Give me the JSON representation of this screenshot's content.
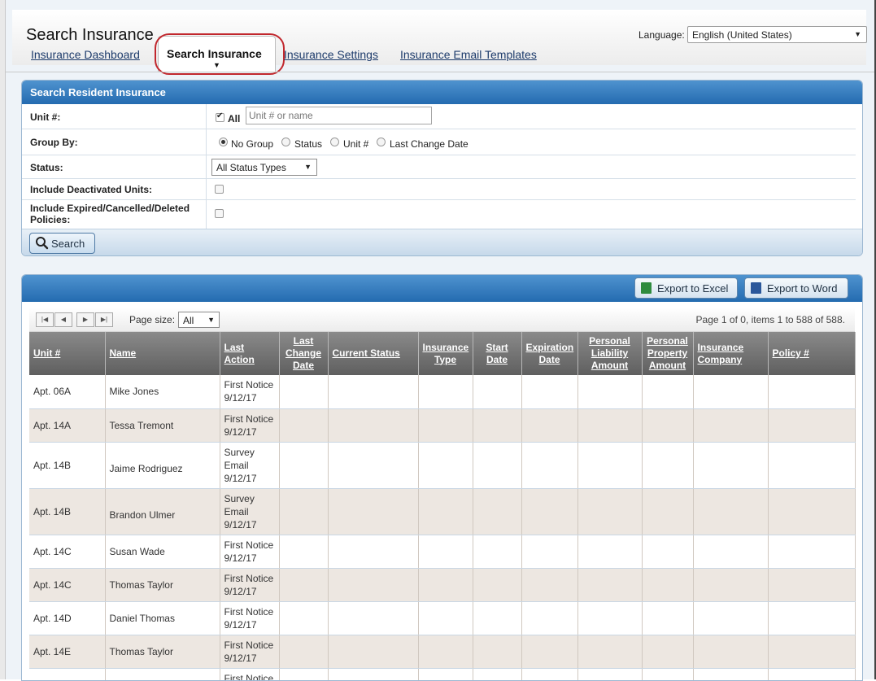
{
  "header": {
    "title": "Search Insurance",
    "language_label": "Language:",
    "language_value": "English (United States)"
  },
  "tabs": [
    {
      "label": "Insurance Dashboard",
      "active": false
    },
    {
      "label": "Search Insurance",
      "active": true
    },
    {
      "label": "Insurance Settings",
      "active": false
    },
    {
      "label": "Insurance Email Templates",
      "active": false
    }
  ],
  "search_panel": {
    "title": "Search Resident Insurance",
    "unit_label": "Unit #:",
    "unit_all_label": "All",
    "unit_all_checked": true,
    "unit_placeholder": "Unit # or name",
    "group_by_label": "Group By:",
    "group_by_options": [
      "No Group",
      "Status",
      "Unit #",
      "Last Change Date"
    ],
    "group_by_selected": "No Group",
    "status_label": "Status:",
    "status_value": "All Status Types",
    "deactivated_label": "Include Deactivated Units:",
    "expired_label": "Include Expired/Cancelled/Deleted Policies:",
    "search_button": "Search"
  },
  "grid": {
    "export_excel": "Export to Excel",
    "export_word": "Export to Word",
    "page_size_label": "Page size:",
    "page_size_value": "All",
    "page_info": "Page 1 of 0, items 1 to 588 of 588.",
    "columns": [
      "Unit #",
      "Name",
      "Last Action",
      "Last Change Date",
      "Current Status",
      "Insurance Type",
      "Start Date",
      "Expiration Date",
      "Personal Liability Amount",
      "Personal Property Amount",
      "Insurance Company",
      "Policy #"
    ],
    "rows": [
      {
        "unit": "Apt. 06A",
        "name": "Mike Jones",
        "action": [
          "First Notice",
          "9/12/17"
        ]
      },
      {
        "unit": "Apt. 14A",
        "name": "Tessa Tremont",
        "action": [
          "First Notice",
          "9/12/17"
        ]
      },
      {
        "unit": "Apt. 14B",
        "name": "Jaime Rodriguez",
        "action": [
          "Survey",
          "Email",
          "9/12/17"
        ]
      },
      {
        "unit": "Apt. 14B",
        "name": "Brandon Ulmer",
        "action": [
          "Survey",
          "Email",
          "9/12/17"
        ]
      },
      {
        "unit": "Apt. 14C",
        "name": "Susan Wade",
        "action": [
          "First Notice",
          "9/12/17"
        ]
      },
      {
        "unit": "Apt. 14C",
        "name": "Thomas Taylor",
        "action": [
          "First Notice",
          "9/12/17"
        ]
      },
      {
        "unit": "Apt. 14D",
        "name": "Daniel Thomas",
        "action": [
          "First Notice",
          "9/12/17"
        ]
      },
      {
        "unit": "Apt. 14E",
        "name": "Thomas Taylor",
        "action": [
          "First Notice",
          "9/12/17"
        ]
      },
      {
        "unit": "",
        "name": "",
        "action": [
          "First Notice",
          ""
        ]
      }
    ]
  },
  "colors": {
    "panel_header": "#246bb0",
    "highlight_oval": "#c1272d",
    "grid_header": "#6e6e6e",
    "alt_row": "#ede7e1"
  }
}
